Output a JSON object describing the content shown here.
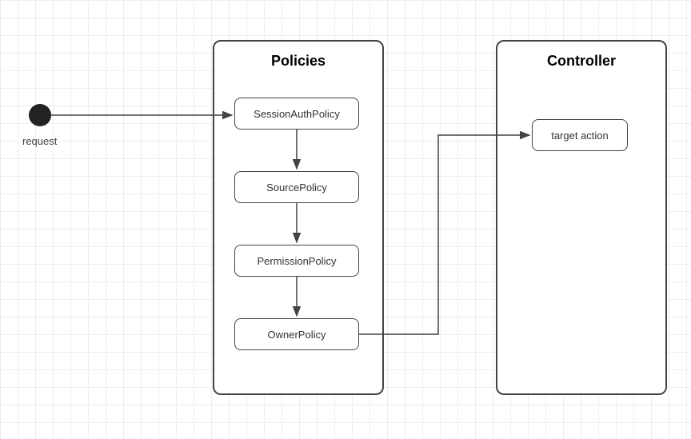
{
  "start_label": "request",
  "policies": {
    "title": "Policies",
    "items": [
      "SessionAuthPolicy",
      "SourcePolicy",
      "PermissionPolicy",
      "OwnerPolicy"
    ]
  },
  "controller": {
    "title": "Controller",
    "target": "target action"
  }
}
